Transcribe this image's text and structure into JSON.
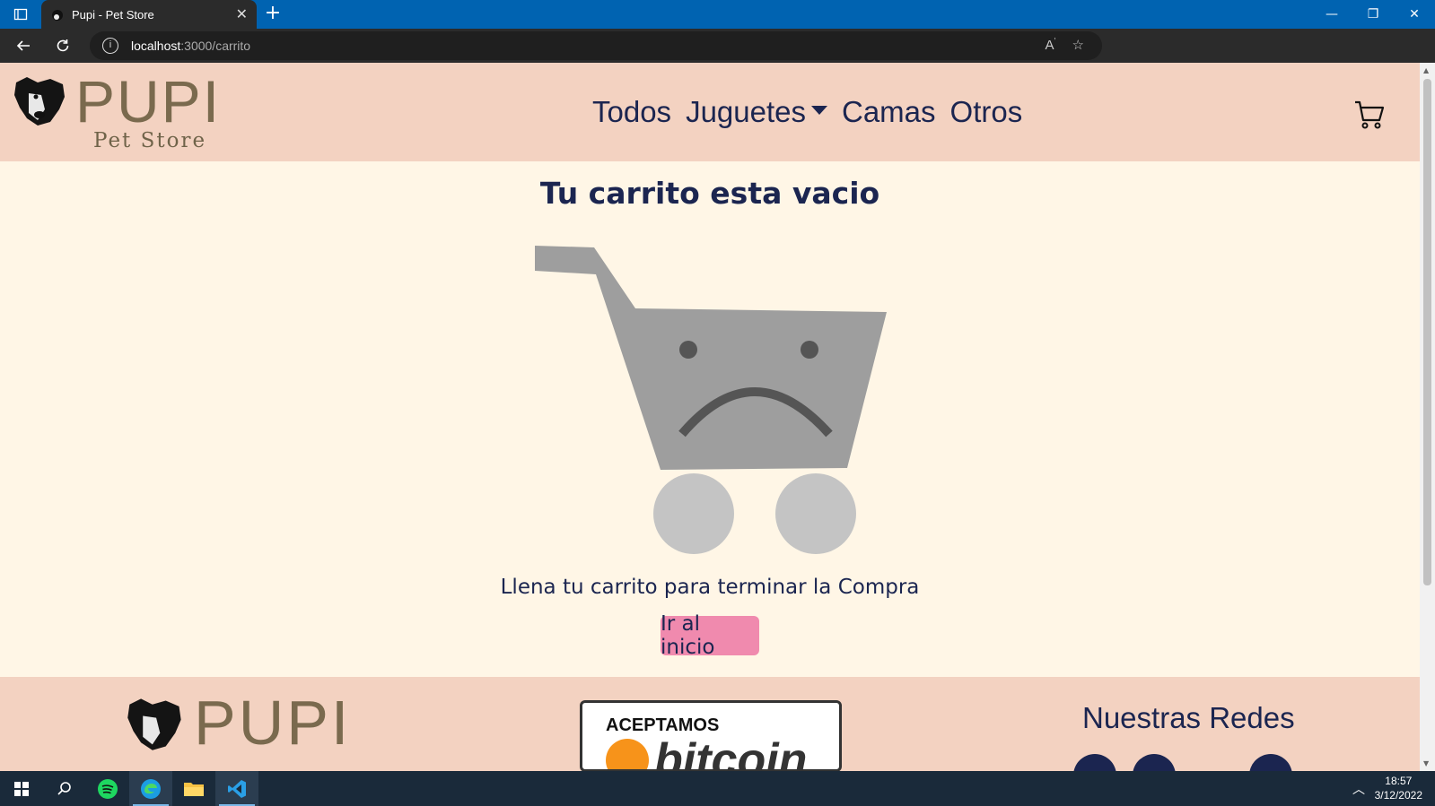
{
  "browser": {
    "tab_title": "Pupi - Pet Store",
    "url_host": "localhost",
    "url_path": ":3000/carrito"
  },
  "header": {
    "logo_word": "PUPI",
    "logo_sub": "Pet Store",
    "nav": [
      "Todos",
      "Juguetes",
      "Camas",
      "Otros"
    ]
  },
  "main": {
    "empty_title": "Tu carrito esta vacio",
    "empty_message": "Llena tu carrito para terminar la Compra",
    "home_button": "Ir al inicio"
  },
  "footer": {
    "logo_word": "PUPI",
    "bitcoin_accept": "ACEPTAMOS",
    "bitcoin_word": "bitcoin",
    "redes_title": "Nuestras Redes"
  },
  "taskbar": {
    "time": "18:57",
    "date": "3/12/2022"
  },
  "colors": {
    "header_bg": "#f3d2c1",
    "page_bg": "#fff6e6",
    "nav_text": "#1b2550",
    "button_bg": "#f08aae",
    "cart_gray": "#9e9e9e"
  }
}
